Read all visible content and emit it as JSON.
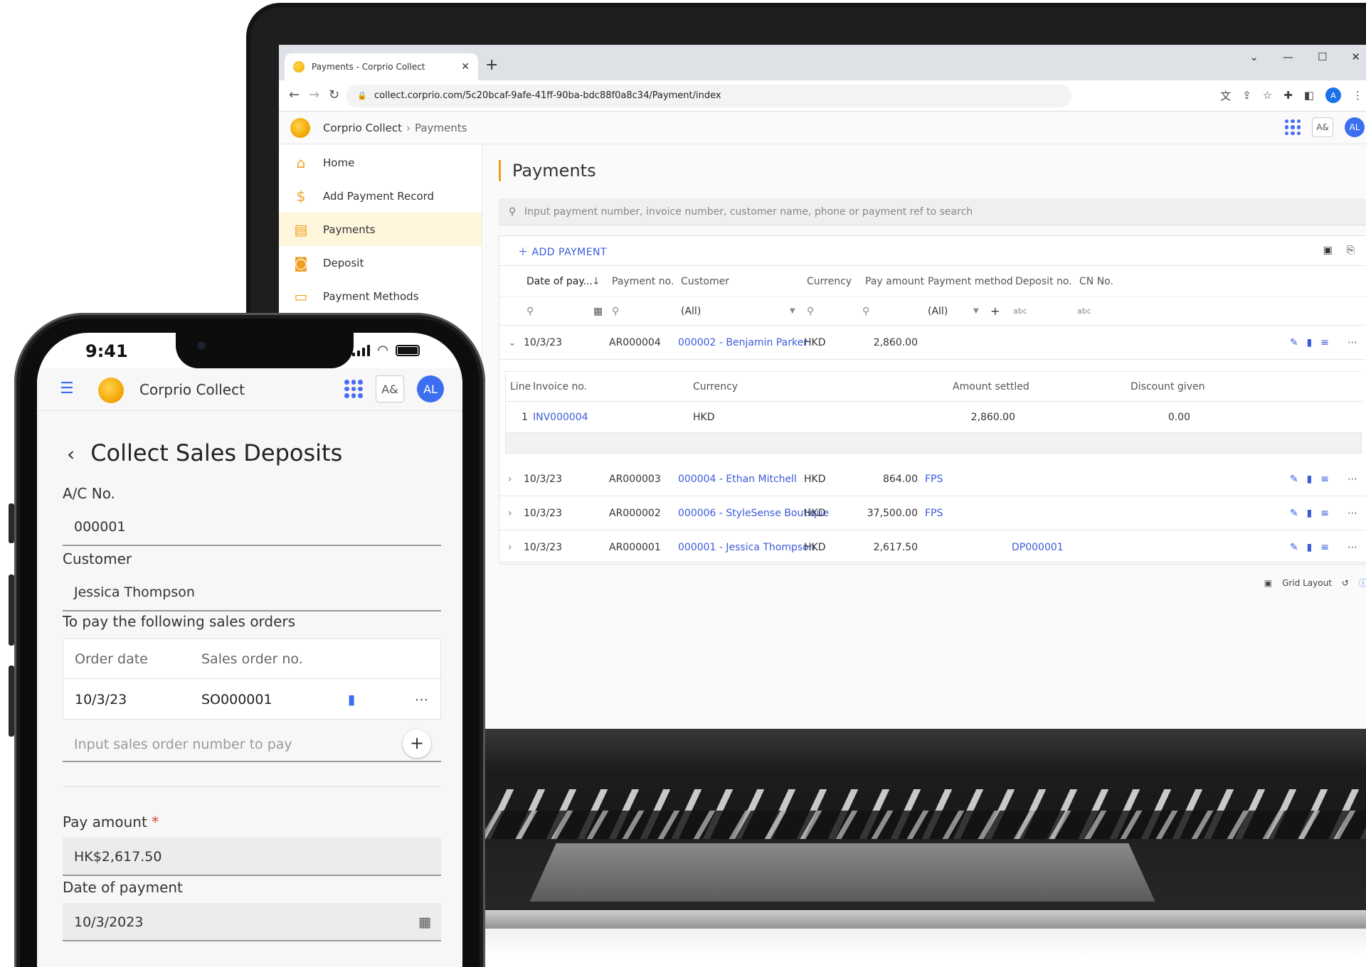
{
  "browser": {
    "tab_title": "Payments - Corprio Collect",
    "url": "collect.corprio.com/5c20bcaf-9afe-41ff-90ba-bdc88f0a8c34/Payment/index",
    "profile_initial": "A"
  },
  "app": {
    "name": "Corprio Collect",
    "breadcrumb": [
      "Corprio Collect",
      "Payments"
    ],
    "lang_label": "A&",
    "user_initials": "AL",
    "colors": {
      "accent": "#f29b1a",
      "link": "#3b5bdb",
      "avatar": "#3b6ff0",
      "active_nav_bg": "#fff6dc"
    }
  },
  "sidebar": {
    "items": [
      {
        "label": "Home",
        "icon": "home-icon"
      },
      {
        "label": "Add Payment Record",
        "icon": "hand-coin-icon"
      },
      {
        "label": "Payments",
        "icon": "invoice-dollar-icon",
        "active": true
      },
      {
        "label": "Deposit",
        "icon": "deposit-icon"
      },
      {
        "label": "Payment Methods",
        "icon": "card-icon"
      }
    ]
  },
  "payments": {
    "title": "Payments",
    "search_placeholder": "Input payment number, invoice number, customer name, phone or payment ref to search",
    "add_label": "ADD PAYMENT",
    "columns": [
      "Date of pay...",
      "Payment no.",
      "Customer",
      "Currency",
      "Pay amount",
      "Payment method",
      "Deposit no.",
      "CN No."
    ],
    "filter_all": "(All)",
    "rows": [
      {
        "date": "10/3/23",
        "no": "AR000004",
        "customer": "000002 - Benjamin Parker",
        "currency": "HKD",
        "amount": "2,860.00",
        "method": "",
        "deposit": "",
        "expanded": true
      },
      {
        "date": "10/3/23",
        "no": "AR000003",
        "customer": "000004 - Ethan Mitchell",
        "currency": "HKD",
        "amount": "864.00",
        "method": "FPS",
        "deposit": ""
      },
      {
        "date": "10/3/23",
        "no": "AR000002",
        "customer": "000006 - StyleSense Boutique",
        "currency": "HKD",
        "amount": "37,500.00",
        "method": "FPS",
        "deposit": ""
      },
      {
        "date": "10/3/23",
        "no": "AR000001",
        "customer": "000001 - Jessica Thompson",
        "currency": "HKD",
        "amount": "2,617.50",
        "method": "",
        "deposit": "DP000001"
      }
    ],
    "detail": {
      "columns": [
        "Line",
        "Invoice no.",
        "Currency",
        "Amount settled",
        "Discount given"
      ],
      "row": {
        "line": "1",
        "invoice": "INV000004",
        "currency": "HKD",
        "settled": "2,860.00",
        "discount": "0.00"
      }
    },
    "footer_label": "Grid Layout"
  },
  "phone": {
    "time": "9:41",
    "form_title": "Collect Sales Deposits",
    "ac_label": "A/C No.",
    "ac_value": "000001",
    "customer_label": "Customer",
    "customer_value": "Jessica Thompson",
    "orders_label": "To pay the following sales orders",
    "order_columns": [
      "Order date",
      "Sales order no."
    ],
    "order_row": {
      "date": "10/3/23",
      "no": "SO000001"
    },
    "order_placeholder": "Input sales order number to pay",
    "pay_label": "Pay amount",
    "pay_value": "HK$2,617.50",
    "date_label": "Date of payment",
    "date_value": "10/3/2023"
  }
}
